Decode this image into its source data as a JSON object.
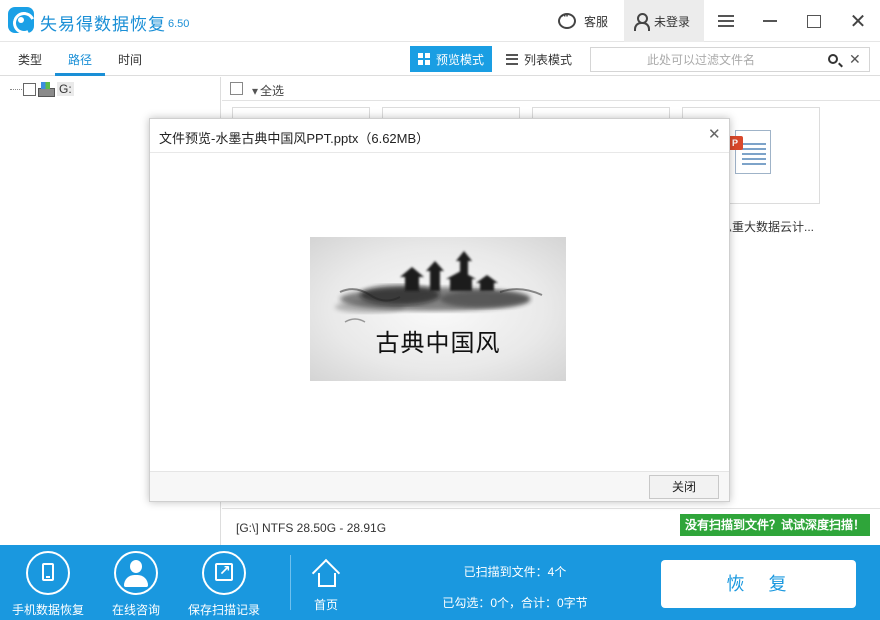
{
  "app": {
    "title": "失易得数据恢复",
    "version": "6.50"
  },
  "header": {
    "support_label": "客服",
    "login_label": "未登录"
  },
  "tabs": [
    {
      "label": "类型"
    },
    {
      "label": "路径"
    },
    {
      "label": "时间"
    }
  ],
  "view_modes": {
    "preview_label": "预览模式",
    "list_label": "列表模式"
  },
  "filter": {
    "placeholder": "此处可以过滤文件名"
  },
  "tree": {
    "drive_label": "G:"
  },
  "toolbar": {
    "select_all_label": "全选"
  },
  "files": [
    {
      "name": ""
    },
    {
      "name": ""
    },
    {
      "name": ""
    },
    {
      "name": "急重大数据云计..."
    }
  ],
  "status": {
    "drive_info": "[G:\\] NTFS 28.50G - 28.91G",
    "deep_scan_label": "没有扫描到文件？试试深度扫描！"
  },
  "bottom": {
    "mobile_label": "手机数据恢复",
    "consult_label": "在线咨询",
    "save_scan_label": "保存扫描记录",
    "home_label": "首页",
    "scanned_text": "已扫描到文件：4个",
    "selected_text": "已勾选：0个，合计：0字节",
    "recover_label": "恢复"
  },
  "dialog": {
    "title": "文件预览-水墨古典中国风PPT.pptx（6.62MB）",
    "slide_title": "古典中国风",
    "close_button_label": "关闭"
  },
  "colors": {
    "accent": "#1a98df",
    "deep_scan": "#2fa53a",
    "ppt_badge": "#d9482b"
  }
}
